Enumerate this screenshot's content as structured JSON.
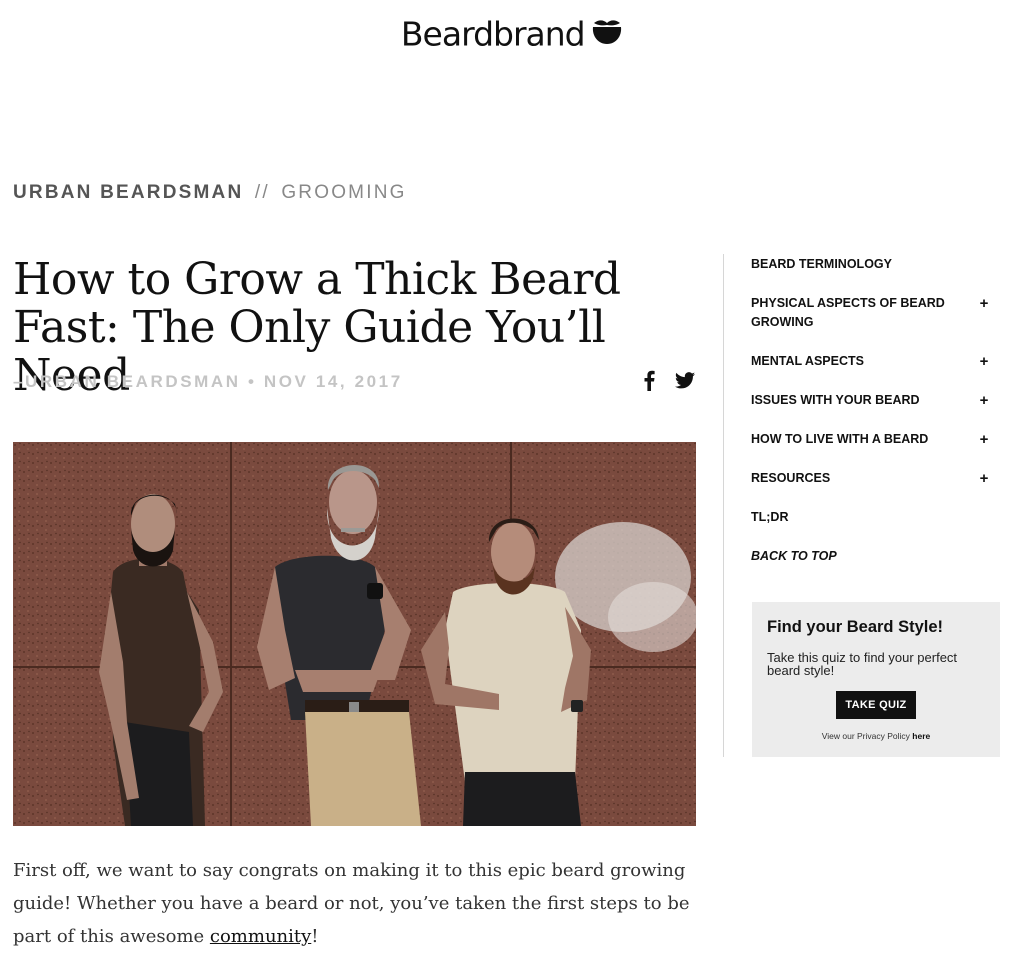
{
  "header": {
    "logo_text": "Beardbrand",
    "logo_icon": "beard-mustache-icon"
  },
  "breadcrumb": {
    "main": "URBAN BEARDSMAN",
    "separator": "//",
    "sub": "GROOMING"
  },
  "article": {
    "title": "How to Grow a Thick Beard Fast: The Only Guide You’ll Need",
    "byline": "–URBAN BEARDSMAN • NOV 14, 2017",
    "share": {
      "facebook_icon": "facebook-icon",
      "twitter_icon": "twitter-icon"
    },
    "body_before_link": "First off, we want to say congrats on making it to this epic beard growing guide! Whether you have a beard or not, you’ve taken the first steps to be part of this awesome ",
    "body_link": "community",
    "body_after_link": "!"
  },
  "toc": {
    "items": [
      {
        "label": "BEARD TERMINOLOGY",
        "expand": ""
      },
      {
        "label": "PHYSICAL ASPECTS OF BEARD GROWING",
        "expand": "+"
      },
      {
        "label": "MENTAL ASPECTS",
        "expand": "+"
      },
      {
        "label": "ISSUES WITH YOUR BEARD",
        "expand": "+"
      },
      {
        "label": "HOW TO LIVE WITH A BEARD",
        "expand": "+"
      },
      {
        "label": "RESOURCES",
        "expand": "+"
      },
      {
        "label": "TL;DR",
        "expand": ""
      },
      {
        "label": "BACK TO TOP",
        "expand": ""
      }
    ]
  },
  "quiz": {
    "title": "Find your Beard Style!",
    "description": "Take this quiz to find your perfect beard style!",
    "button": "TAKE QUIZ",
    "privacy_text": "View our Privacy Policy ",
    "privacy_link": "here"
  },
  "colors": {
    "text": "#111111",
    "byline": "#c4c4c4",
    "quiz_bg": "#ececec",
    "granite": "#7a4a3e"
  }
}
